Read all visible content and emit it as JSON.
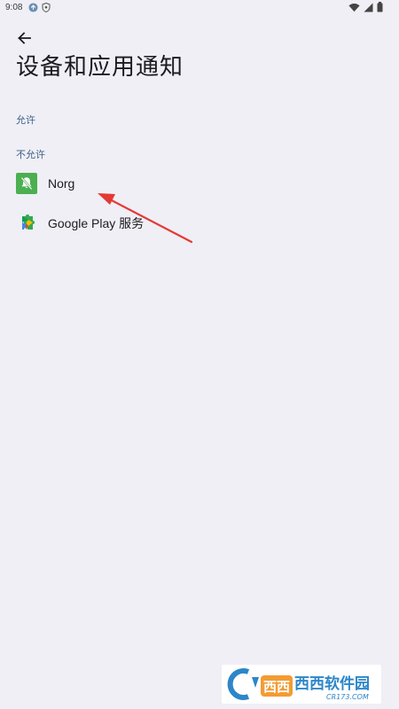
{
  "status_bar": {
    "time": "9:08"
  },
  "header": {
    "title": "设备和应用通知"
  },
  "sections": {
    "allowed_label": "允许",
    "disallowed_label": "不允许"
  },
  "apps": [
    {
      "label": "Norg",
      "icon": "notifications-off-icon",
      "icon_bg": "#4caf50"
    },
    {
      "label": "Google Play 服务",
      "icon": "google-play-services-icon"
    }
  ],
  "watermark": {
    "text_cn": "西西软件园",
    "text_url": "CR173.COM"
  },
  "colors": {
    "background": "#efeff5",
    "section_header": "#3e5f86",
    "arrow": "#e53935"
  }
}
